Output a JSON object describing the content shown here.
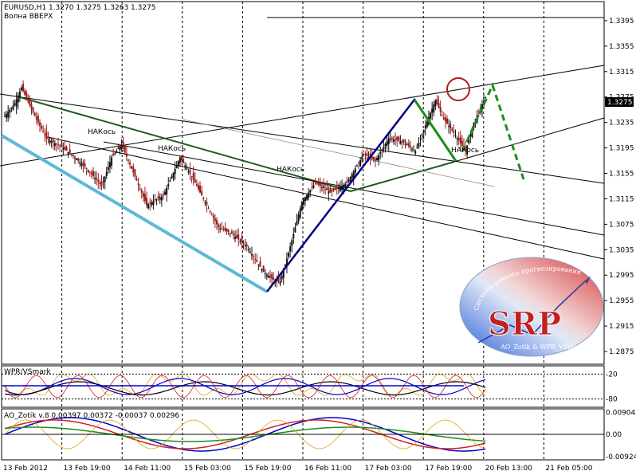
{
  "header": {
    "symbol_line": "EURUSD,H1  1.3270 1.3275 1.3263 1.3275",
    "subtitle": "Волна ВВЕРХ"
  },
  "colors": {
    "up_candle": "#111111",
    "down_candle": "#9b1b1b",
    "grid": "#000000",
    "blue_wave": "#000080",
    "cyan_line": "#5fb8d6",
    "dark_green": "#1f5a1f",
    "bright_green": "#1a8f1a",
    "forecast": "#1a8f1a",
    "circle": "#b11a1a"
  },
  "chart_data": [
    {
      "type": "candlestick",
      "title": "EURUSD,H1",
      "ohlc": {
        "open": 1.327,
        "high": 1.3275,
        "low": 1.3263,
        "close": 1.3275
      },
      "ylim": [
        1.2855,
        1.3425
      ],
      "y_ticks": [
        "1.3395",
        "1.3355",
        "1.3315",
        "1.3275",
        "1.3235",
        "1.3195",
        "1.3155",
        "1.3115",
        "1.3075",
        "1.3035",
        "1.2995",
        "1.2955",
        "1.2915",
        "1.2875"
      ],
      "y_tick_values": [
        1.3395,
        1.3355,
        1.3315,
        1.3275,
        1.3235,
        1.3195,
        1.3155,
        1.3115,
        1.3075,
        1.3035,
        1.2995,
        1.2955,
        1.2915,
        1.2875
      ],
      "current_price": "1.3275",
      "x_ticks": [
        "13 Feb 2012",
        "13 Feb 19:00",
        "14 Feb 11:00",
        "15 Feb 03:00",
        "15 Feb 19:00",
        "16 Feb 11:00",
        "17 Feb 03:00",
        "17 Feb 19:00",
        "20 Feb 13:00",
        "21 Feb 05:00"
      ],
      "annotations": [
        "НАКось",
        "НАКось",
        "НАКось",
        "НАКось"
      ],
      "path_points": [
        [
          0,
          1.3245
        ],
        [
          6,
          1.3265
        ],
        [
          10,
          1.329
        ],
        [
          18,
          1.3245
        ],
        [
          25,
          1.321
        ],
        [
          35,
          1.3195
        ],
        [
          42,
          1.318
        ],
        [
          50,
          1.316
        ],
        [
          58,
          1.3135
        ],
        [
          64,
          1.318
        ],
        [
          70,
          1.32
        ],
        [
          78,
          1.315
        ],
        [
          85,
          1.3105
        ],
        [
          95,
          1.312
        ],
        [
          105,
          1.318
        ],
        [
          112,
          1.315
        ],
        [
          120,
          1.311
        ],
        [
          128,
          1.307
        ],
        [
          136,
          1.306
        ],
        [
          145,
          1.304
        ],
        [
          155,
          1.3
        ],
        [
          162,
          1.2985
        ],
        [
          165,
          1.2985
        ],
        [
          170,
          1.303
        ],
        [
          178,
          1.311
        ],
        [
          186,
          1.314
        ],
        [
          195,
          1.3125
        ],
        [
          205,
          1.314
        ],
        [
          215,
          1.3185
        ],
        [
          222,
          1.3175
        ],
        [
          230,
          1.321
        ],
        [
          238,
          1.3205
        ],
        [
          246,
          1.319
        ],
        [
          252,
          1.323
        ],
        [
          258,
          1.327
        ],
        [
          263,
          1.324
        ],
        [
          270,
          1.3215
        ],
        [
          276,
          1.319
        ],
        [
          281,
          1.3235
        ],
        [
          288,
          1.3275
        ]
      ]
    },
    {
      "type": "line",
      "title": "WPR/VSmark",
      "y_ticks": [
        "-20",
        "-80"
      ],
      "y_tick_values": [
        -20,
        -80
      ],
      "ylim": [
        -100,
        0
      ]
    },
    {
      "type": "line",
      "title": "AO_Zotik v.8 0.00397 0.00372 -0.00037 0.00296",
      "y_ticks": [
        "0.00904",
        "0.00",
        "-0.00924"
      ],
      "y_tick_values": [
        0.00904,
        0.0,
        -0.00924
      ],
      "ylim": [
        -0.0105,
        0.0105
      ]
    }
  ],
  "logo": {
    "text": "SRP",
    "arc_text": "Система раннего прогнозирования",
    "bottom_text": "AO_Zotik & WPR_VSmark"
  }
}
